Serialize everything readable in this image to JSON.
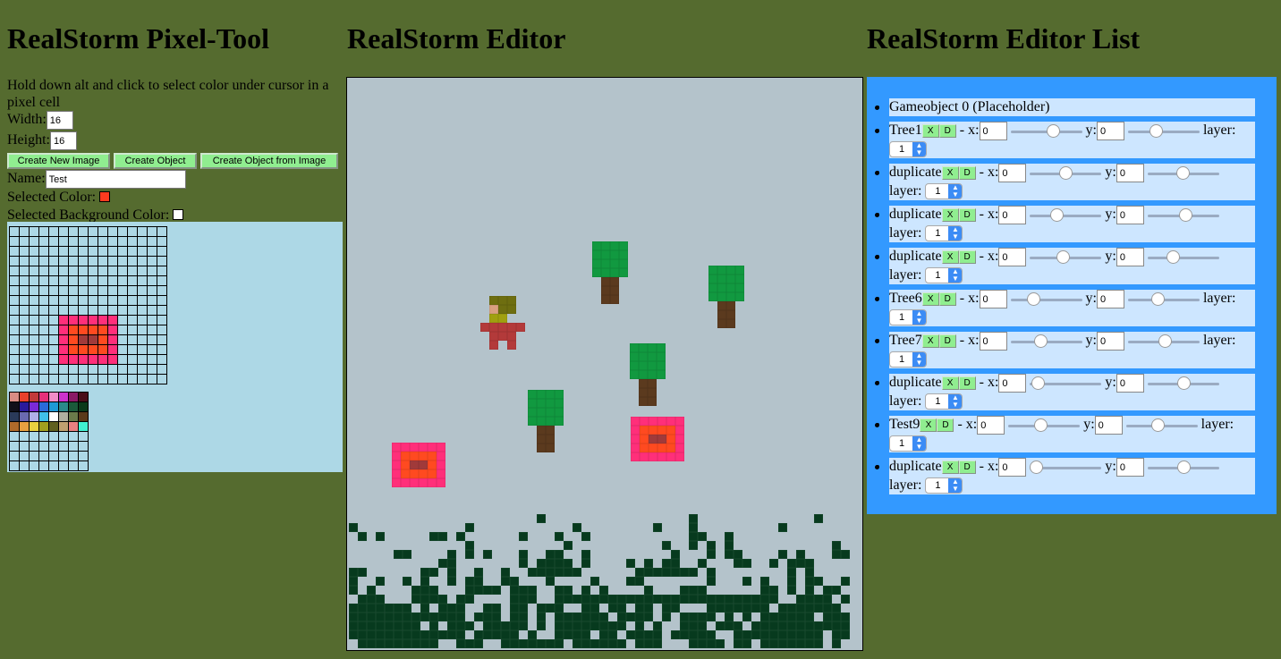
{
  "headings": {
    "pixel_tool": "RealStorm Pixel-Tool",
    "editor": "RealStorm Editor",
    "list": "RealStorm Editor List"
  },
  "pixel_tool": {
    "instructions": "Hold down alt and click to select color under cursor in a pixel cell",
    "width_label": "Width:",
    "width_value": "16",
    "height_label": "Height:",
    "height_value": "16",
    "buttons": {
      "new_image": "Create New Image",
      "create_object": "Create Object",
      "object_from_image": "Create Object from Image"
    },
    "name_label": "Name:",
    "name_value": "Test",
    "selected_color_label": "Selected Color:",
    "selected_color": "#ff3b1f",
    "selected_bg_label": "Selected Background Color:",
    "selected_bg": "#ffffff",
    "area_bg": "#add8e6",
    "palette_rows": [
      [
        "#d98c84",
        "#e8412c",
        "#c23a3a",
        "#e6307a",
        "#f08cc8",
        "#cc33cc",
        "#8a1a66",
        "#4a0f1a"
      ],
      [
        "#10101a",
        "#2a1a9c",
        "#7a2ad9",
        "#2a6ad9",
        "#1e9ad6",
        "#2a8a8a",
        "#1a5a3a",
        "#0a3a1a"
      ],
      [
        "#2a3a5a",
        "#6a6ab0",
        "#b0b0e8",
        "#40c0e8",
        "#ffffff",
        "#b0b0a0",
        "#6a7a4a",
        "#5a3a1a"
      ],
      [
        "#b06a2a",
        "#e8a040",
        "#e8d040",
        "#a0a020",
        "#606020",
        "#c0a070",
        "#e88080",
        "#40f0d0"
      ],
      [
        "#add8e6",
        "#add8e6",
        "#add8e6",
        "#add8e6",
        "#add8e6",
        "#add8e6",
        "#add8e6",
        "#add8e6"
      ],
      [
        "#add8e6",
        "#add8e6",
        "#add8e6",
        "#add8e6",
        "#add8e6",
        "#add8e6",
        "#add8e6",
        "#add8e6"
      ],
      [
        "#add8e6",
        "#add8e6",
        "#add8e6",
        "#add8e6",
        "#add8e6",
        "#add8e6",
        "#add8e6",
        "#add8e6"
      ],
      [
        "#add8e6",
        "#add8e6",
        "#add8e6",
        "#add8e6",
        "#add8e6",
        "#add8e6",
        "#add8e6",
        "#add8e6"
      ]
    ]
  },
  "editor": {
    "background": "#b4c3cb",
    "colors": {
      "leaf": "#119940",
      "trunk": "#5b3a1e",
      "pad_outer": "#ff2f7a",
      "pad_inner": "#ff4a20",
      "pad_core": "#a03a3a",
      "hair": "#6e6e10",
      "skin": "#d9a080",
      "shirt": "#a0a010",
      "body": "#b33a3a",
      "bush": "#073a1e"
    }
  },
  "list": {
    "items": [
      {
        "name": "Gameobject 0 (Placeholder)",
        "placeholder": true
      },
      {
        "name": "Tree1",
        "x": "0",
        "y": "0",
        "x_slider": 0.62,
        "y_slider": 0.37,
        "layer": "1"
      },
      {
        "name": "duplicate",
        "x": "0",
        "y": "0",
        "x_slider": 0.5,
        "y_slider": 0.5,
        "layer": "1"
      },
      {
        "name": "duplicate",
        "x": "0",
        "y": "0",
        "x_slider": 0.35,
        "y_slider": 0.54,
        "layer": "1"
      },
      {
        "name": "duplicate",
        "x": "0",
        "y": "0",
        "x_slider": 0.45,
        "y_slider": 0.33,
        "layer": "1"
      },
      {
        "name": "Tree6",
        "x": "0",
        "y": "0",
        "x_slider": 0.28,
        "y_slider": 0.4,
        "layer": "1"
      },
      {
        "name": "Tree7",
        "x": "0",
        "y": "0",
        "x_slider": 0.4,
        "y_slider": 0.52,
        "layer": "1"
      },
      {
        "name": "duplicate",
        "x": "0",
        "y": "0",
        "x_slider": 0.02,
        "y_slider": 0.51,
        "layer": "1"
      },
      {
        "name": "Test9",
        "x": "0",
        "y": "0",
        "x_slider": 0.45,
        "y_slider": 0.43,
        "layer": "1"
      },
      {
        "name": "duplicate",
        "x": "0",
        "y": "0",
        "x_slider": 0.0,
        "y_slider": 0.51,
        "layer": "1"
      }
    ],
    "btn_x": "X",
    "btn_d": "D",
    "x_label": "- x:",
    "y_label": "y:",
    "layer_label": "layer:",
    "select_arrow": "⌃⌄"
  }
}
